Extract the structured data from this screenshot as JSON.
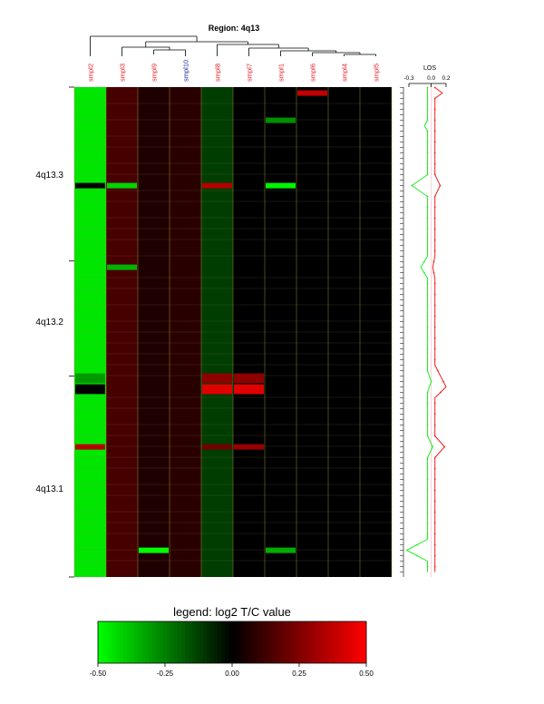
{
  "chart_data": {
    "type": "heatmap",
    "title": "Region: 4q13",
    "samples": [
      {
        "name": "smpl2",
        "color": "#e4202a"
      },
      {
        "name": "smpl3",
        "color": "#e4202a"
      },
      {
        "name": "smpl9",
        "color": "#e4202a"
      },
      {
        "name": "smpl10",
        "color": "#1c2a9c"
      },
      {
        "name": "smpl8",
        "color": "#e4202a"
      },
      {
        "name": "smpl7",
        "color": "#e4202a"
      },
      {
        "name": "smpl1",
        "color": "#e4202a"
      },
      {
        "name": "smpl6",
        "color": "#e4202a"
      },
      {
        "name": "smpl4",
        "color": "#e4202a"
      },
      {
        "name": "smpl5",
        "color": "#e4202a"
      }
    ],
    "bands": [
      "4q13.3",
      "4q13.2",
      "4q13.1"
    ],
    "sample_base_values": [
      -0.45,
      0.14,
      0.06,
      0.08,
      -0.12,
      0.0,
      0.0,
      0.0,
      0.0,
      0.0
    ],
    "highlights": [
      {
        "sample": "smpl6",
        "row": 1,
        "value": 0.38
      },
      {
        "sample": "smpl1",
        "row": 6,
        "value": -0.28
      },
      {
        "sample": "smpl2",
        "row": 18,
        "value": 0.0
      },
      {
        "sample": "smpl3",
        "row": 18,
        "value": -0.42
      },
      {
        "sample": "smpl8",
        "row": 18,
        "value": 0.35
      },
      {
        "sample": "smpl1",
        "row": 18,
        "value": -0.48
      },
      {
        "sample": "smpl3",
        "row": 33,
        "value": -0.35
      },
      {
        "sample": "smpl2",
        "row": 53,
        "value": -0.3
      },
      {
        "sample": "smpl8",
        "row": 53,
        "value": 0.28
      },
      {
        "sample": "smpl7",
        "row": 53,
        "value": 0.28
      },
      {
        "sample": "smpl2",
        "row": 55,
        "value": 0.0
      },
      {
        "sample": "smpl8",
        "row": 55,
        "value": 0.44
      },
      {
        "sample": "smpl7",
        "row": 55,
        "value": 0.44
      },
      {
        "sample": "smpl2",
        "row": 66,
        "value": 0.36
      },
      {
        "sample": "smpl8",
        "row": 66,
        "value": 0.22
      },
      {
        "sample": "smpl7",
        "row": 66,
        "value": 0.3
      },
      {
        "sample": "smpl9",
        "row": 85,
        "value": -0.5
      },
      {
        "sample": "smpl1",
        "row": 85,
        "value": -0.34
      }
    ],
    "los": {
      "label": "LOS",
      "ticks": [
        "-0.3",
        "0.0",
        "0.2"
      ],
      "xlim": [
        -0.3,
        0.2
      ],
      "green": [
        {
          "row": 0,
          "value": -0.05
        },
        {
          "row": 6,
          "value": -0.05
        },
        {
          "row": 7,
          "value": -0.09
        },
        {
          "row": 8,
          "value": -0.05
        },
        {
          "row": 16,
          "value": -0.05
        },
        {
          "row": 18,
          "value": -0.26
        },
        {
          "row": 20,
          "value": -0.05
        },
        {
          "row": 31,
          "value": -0.05
        },
        {
          "row": 33,
          "value": -0.14
        },
        {
          "row": 35,
          "value": -0.05
        },
        {
          "row": 52,
          "value": -0.05
        },
        {
          "row": 54,
          "value": 0.0
        },
        {
          "row": 56,
          "value": -0.05
        },
        {
          "row": 64,
          "value": -0.05
        },
        {
          "row": 66,
          "value": 0.02
        },
        {
          "row": 68,
          "value": -0.05
        },
        {
          "row": 83,
          "value": -0.05
        },
        {
          "row": 85,
          "value": -0.33
        },
        {
          "row": 87,
          "value": -0.05
        },
        {
          "row": 89,
          "value": -0.05
        }
      ],
      "red": [
        {
          "row": 0,
          "value": 0.05
        },
        {
          "row": 1,
          "value": 0.15
        },
        {
          "row": 2,
          "value": 0.05
        },
        {
          "row": 16,
          "value": 0.05
        },
        {
          "row": 18,
          "value": 0.12
        },
        {
          "row": 20,
          "value": 0.05
        },
        {
          "row": 31,
          "value": 0.05
        },
        {
          "row": 33,
          "value": 0.02
        },
        {
          "row": 35,
          "value": 0.05
        },
        {
          "row": 51,
          "value": 0.05
        },
        {
          "row": 55,
          "value": 0.2
        },
        {
          "row": 57,
          "value": 0.05
        },
        {
          "row": 64,
          "value": 0.05
        },
        {
          "row": 66,
          "value": 0.18
        },
        {
          "row": 68,
          "value": 0.05
        },
        {
          "row": 89,
          "value": 0.05
        }
      ]
    },
    "legend": {
      "title": "legend: log2 T/C value",
      "ticks": [
        "-0.50",
        "-0.25",
        "0.00",
        "0.25",
        "0.50"
      ],
      "range": [
        -0.5,
        0.5
      ]
    },
    "colors": {
      "low": "#00ff00",
      "mid": "#000000",
      "high": "#ff0000",
      "los_green": "#22ee22",
      "los_red": "#ee2222"
    }
  }
}
